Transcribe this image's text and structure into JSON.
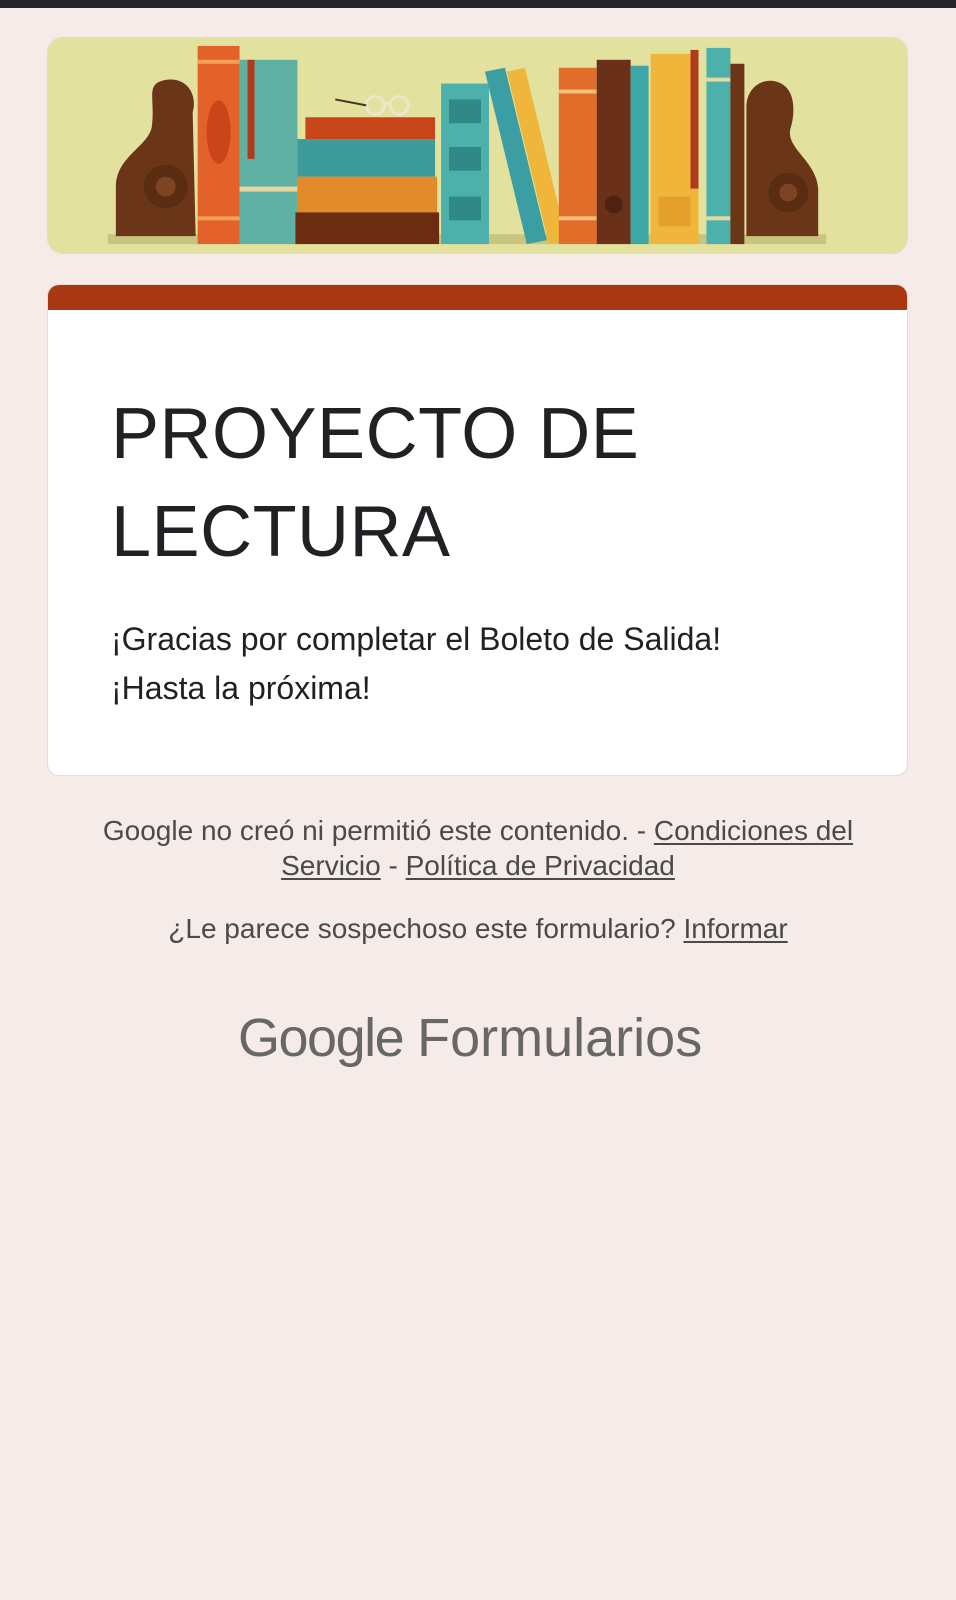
{
  "form": {
    "title": "PROYECTO DE LECTURA",
    "message_lines": [
      "¡Gracias por completar el Boleto de Salida!",
      "¡Hasta la próxima!"
    ]
  },
  "footer": {
    "disclaimer": "Google no creó ni permitió este contenido. - ",
    "terms_link": "Condiciones del Servicio",
    "separator": " - ",
    "privacy_link": "Política de Privacidad",
    "report_question": "¿Le parece sospechoso este formulario? ",
    "report_link": "Informar"
  },
  "brand": {
    "google": "Google",
    "product": "Formularios"
  },
  "colors": {
    "page_background": "#f5ebe8",
    "accent": "#a93712",
    "card_background": "#ffffff",
    "text_primary": "#202124",
    "footer_text": "#4a4a4a"
  },
  "icons": {
    "header_image": "bookshelf-illustration"
  }
}
